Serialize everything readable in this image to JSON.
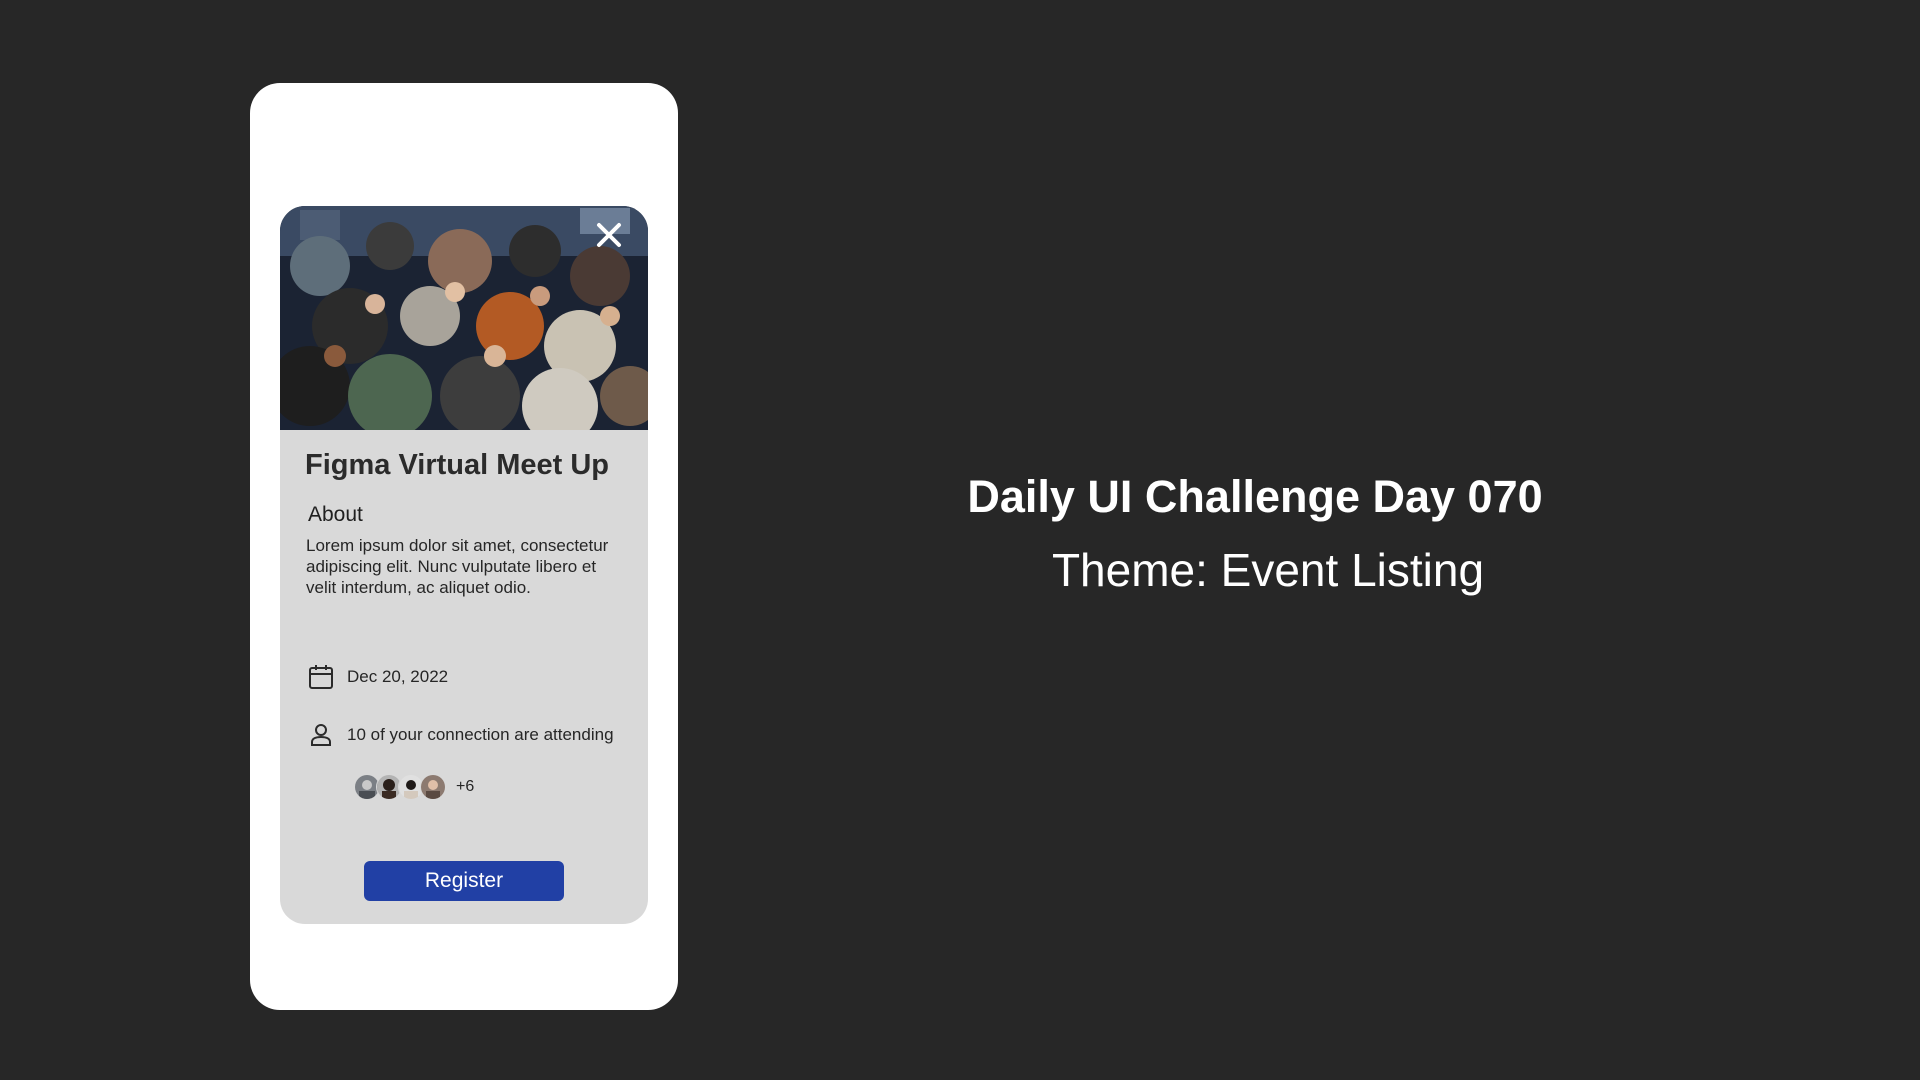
{
  "slide": {
    "title": "Daily UI Challenge Day 070",
    "subtitle": "Theme: Event Listing",
    "background_color": "#272727"
  },
  "event_card": {
    "image_icon": "crowd-photo",
    "close_icon": "close-icon",
    "title": "Figma Virtual Meet Up",
    "about_heading": "About",
    "about_text": "Lorem ipsum dolor sit amet, consectetur adipiscing elit. Nunc vulputate libero et velit interdum, ac aliquet odio.",
    "date_icon": "calendar-icon",
    "date": "Dec 20, 2022",
    "attendees_icon": "person-icon",
    "attendees_text": "10 of your connection are attending",
    "attendee_avatars": [
      "avatar-1",
      "avatar-2",
      "avatar-3",
      "avatar-4"
    ],
    "attendees_more": "+6",
    "register_label": "Register",
    "card_color": "#d9d9d9",
    "accent_color": "#2140a5"
  }
}
